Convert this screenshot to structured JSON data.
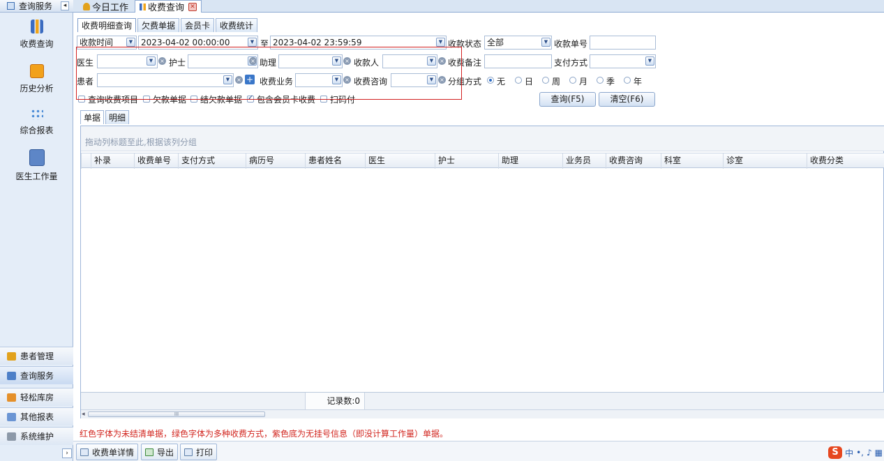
{
  "sidebar": {
    "header": "查询服务",
    "items": [
      {
        "label": "收费查询"
      },
      {
        "label": "历史分析"
      },
      {
        "label": "综合报表"
      },
      {
        "label": "医生工作量"
      }
    ],
    "categories": [
      {
        "label": "患者管理"
      },
      {
        "label": "查询服务"
      },
      {
        "label": "轻松库房"
      },
      {
        "label": "其他报表"
      },
      {
        "label": "系统维护"
      }
    ]
  },
  "tabs": {
    "today": "今日工作",
    "charge_query": "收费查询"
  },
  "subtabs": [
    "收费明细查询",
    "欠费单据",
    "会员卡",
    "收费统计"
  ],
  "form": {
    "time_type": "收款时间",
    "start_time": "2023-04-02 00:00:00",
    "to_label": "至",
    "end_time": "2023-04-02 23:59:59",
    "pay_status_label": "收款状态",
    "pay_status_value": "全部",
    "receipt_no_label": "收款单号",
    "doctor_label": "医生",
    "nurse_label": "护士",
    "assistant_label": "助理",
    "payee_label": "收款人",
    "remark_label": "收费备注",
    "pay_method_label": "支付方式",
    "patient_label": "患者",
    "business_label": "收费业务",
    "consult_label": "收费咨询",
    "group_label": "分组方式",
    "group_options": [
      "无",
      "日",
      "周",
      "月",
      "季",
      "年"
    ],
    "group_selected": "无",
    "checkboxes": [
      {
        "label": "查询收费项目",
        "checked": false
      },
      {
        "label": "欠款单据",
        "checked": false
      },
      {
        "label": "结欠款单据",
        "checked": false
      },
      {
        "label": "包含会员卡收费",
        "checked": true
      },
      {
        "label": "扫码付",
        "checked": false
      }
    ],
    "query_button": "查询(F5)",
    "clear_button": "清空(F6)"
  },
  "inner_tabs": [
    "单据",
    "明细"
  ],
  "grid": {
    "group_hint": "拖动列标题至此,根据该列分组",
    "columns": [
      "补录",
      "收费单号",
      "支付方式",
      "病历号",
      "患者姓名",
      "医生",
      "护士",
      "助理",
      "业务员",
      "收费咨询",
      "科室",
      "诊室",
      "收费分类"
    ],
    "record_count": "记录数:0",
    "scroll_grip": "III"
  },
  "note": "红色字体为未结清单据，绿色字体为多种收费方式，紫色底为无挂号信息（即没计算工作量）单据。",
  "bottom_buttons": [
    "收费单详情",
    "导出",
    "打印"
  ],
  "ime": {
    "logo": "S",
    "mode": "中"
  },
  "colors": {
    "red_outline": "#d21f1f",
    "note_text": "#d2261f",
    "accent": "#2c6bc4"
  }
}
